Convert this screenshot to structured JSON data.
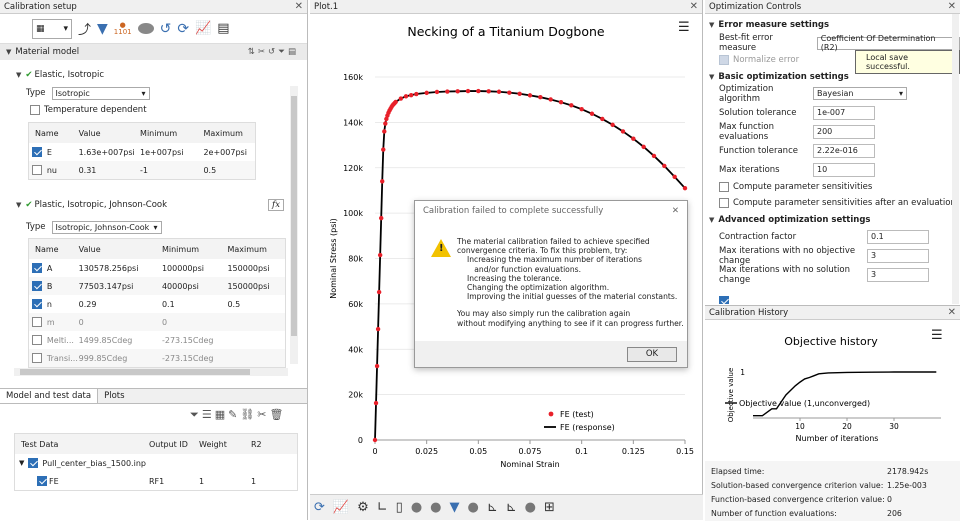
{
  "left": {
    "title": "Calibration setup",
    "section": "Material model",
    "elastic": {
      "name": "Elastic, Isotropic",
      "type_label": "Type",
      "type_value": "Isotropic",
      "temp_label": "Temperature dependent",
      "columns": [
        "Name",
        "Value",
        "Minimum",
        "Maximum"
      ],
      "rows": [
        {
          "name": "E",
          "value": "1.63e+007psi",
          "min": "1e+007psi",
          "max": "2e+007psi",
          "checked": true
        },
        {
          "name": "nu",
          "value": "0.31",
          "min": "-1",
          "max": "0.5",
          "checked": false
        }
      ]
    },
    "plastic": {
      "name": "Plastic, Isotropic, Johnson-Cook",
      "fx": "fx",
      "type_label": "Type",
      "type_value": "Isotropic, Johnson-Cook",
      "columns": [
        "Name",
        "Value",
        "Minimum",
        "Maximum"
      ],
      "rows": [
        {
          "name": "A",
          "value": "130578.256psi",
          "min": "100000psi",
          "max": "150000psi",
          "checked": true
        },
        {
          "name": "B",
          "value": "77503.147psi",
          "min": "40000psi",
          "max": "150000psi",
          "checked": true
        },
        {
          "name": "n",
          "value": "0.29",
          "min": "0.1",
          "max": "0.5",
          "checked": true
        },
        {
          "name": "m",
          "value": "0",
          "min": "0",
          "max": "",
          "checked": false
        },
        {
          "name": "Melti...",
          "value": "1499.85Cdeg",
          "min": "-273.15Cdeg",
          "max": "",
          "checked": false
        },
        {
          "name": "Transi...",
          "value": "999.85Cdeg",
          "min": "-273.15Cdeg",
          "max": "",
          "checked": false
        }
      ]
    },
    "tabs": [
      "Model and test data",
      "Plots"
    ],
    "data_table": {
      "columns": [
        "Test Data",
        "Output ID",
        "Weight",
        "R2"
      ],
      "parent": "Pull_center_bias_1500.inp",
      "child": {
        "name": "FE",
        "output": "RF1",
        "weight": "1",
        "r2": "1"
      }
    }
  },
  "plot": {
    "tab": "Plot.1",
    "chart_data": {
      "type": "scatter",
      "title": "Necking of a Titanium Dogbone",
      "xlabel": "Nominal Strain",
      "ylabel": "Nominal Stress (psi)",
      "xlim": [
        0,
        0.15
      ],
      "ylim": [
        0,
        160000
      ],
      "xticks": [
        "0",
        "0.025",
        "0.05",
        "0.075",
        "0.1",
        "0.125",
        "0.15"
      ],
      "yticks": [
        "0",
        "20k",
        "40k",
        "60k",
        "80k",
        "100k",
        "120k",
        "140k",
        "160k"
      ],
      "series": [
        {
          "name": "FE (test)",
          "style": "markers",
          "color": "#e8202a",
          "x": [
            0,
            0.0005,
            0.001,
            0.0015,
            0.002,
            0.0025,
            0.003,
            0.0035,
            0.004,
            0.0045,
            0.005,
            0.0055,
            0.006,
            0.0065,
            0.007,
            0.0075,
            0.008,
            0.0085,
            0.009,
            0.0095,
            0.01,
            0.0125,
            0.015,
            0.0175,
            0.02,
            0.025,
            0.03,
            0.035,
            0.04,
            0.045,
            0.05,
            0.055,
            0.06,
            0.065,
            0.07,
            0.075,
            0.08,
            0.085,
            0.09,
            0.095,
            0.1,
            0.105,
            0.11,
            0.115,
            0.12,
            0.125,
            0.13,
            0.135,
            0.14,
            0.145,
            0.15
          ],
          "y": [
            0,
            16300,
            32600,
            48900,
            65200,
            81500,
            97800,
            114000,
            128000,
            136000,
            139500,
            141500,
            143000,
            144200,
            145200,
            146000,
            146800,
            147500,
            148000,
            148500,
            149000,
            150500,
            151500,
            152000,
            152500,
            153000,
            153400,
            153600,
            153700,
            153800,
            153800,
            153700,
            153500,
            153100,
            152600,
            151900,
            151100,
            150100,
            148900,
            147500,
            145800,
            143800,
            141500,
            138900,
            136000,
            132800,
            129200,
            125200,
            120800,
            116000,
            111000
          ]
        },
        {
          "name": "FE (response)",
          "style": "line",
          "color": "#000000",
          "x": [
            0,
            0.0005,
            0.001,
            0.0015,
            0.002,
            0.0025,
            0.003,
            0.0035,
            0.004,
            0.0045,
            0.005,
            0.0055,
            0.006,
            0.0065,
            0.007,
            0.0075,
            0.008,
            0.0085,
            0.009,
            0.0095,
            0.01,
            0.0125,
            0.015,
            0.0175,
            0.02,
            0.025,
            0.03,
            0.035,
            0.04,
            0.045,
            0.05,
            0.055,
            0.06,
            0.065,
            0.07,
            0.075,
            0.08,
            0.085,
            0.09,
            0.095,
            0.1,
            0.105,
            0.11,
            0.115,
            0.12,
            0.125,
            0.13,
            0.135,
            0.14,
            0.145,
            0.15
          ],
          "y": [
            0,
            16300,
            32600,
            48900,
            65200,
            81500,
            97800,
            114000,
            128000,
            136000,
            139500,
            141500,
            143000,
            144200,
            145200,
            146000,
            146800,
            147500,
            148000,
            148500,
            149000,
            150500,
            151500,
            152000,
            152500,
            153000,
            153400,
            153600,
            153700,
            153800,
            153800,
            153700,
            153500,
            153100,
            152600,
            151900,
            151100,
            150100,
            148900,
            147500,
            145800,
            143800,
            141500,
            138900,
            136000,
            132800,
            129200,
            125200,
            120800,
            116000,
            111000
          ]
        }
      ]
    }
  },
  "dialog": {
    "title": "Calibration failed to complete successfully",
    "lines": [
      "The material calibration failed to achieve specified",
      "convergence criteria.  To fix this problem, try:"
    ],
    "indent": [
      "Increasing the maximum number of iterations",
      "   and/or function evaluations.",
      "Increasing the tolerance.",
      "Changing the optimization algorithm.",
      "Improving the initial guesses of the material constants."
    ],
    "footer": [
      "You may also simply run the calibration again",
      "without modifying anything to see if it can progress further."
    ],
    "ok": "OK"
  },
  "opt": {
    "title": "Optimization Controls",
    "err_section": "Error measure settings",
    "best_fit_label": "Best-fit error measure",
    "best_fit_value": "Coefficient Of Determination (R2)",
    "normalize_label": "Normalize error",
    "tooltip": "Local save successful.",
    "basic_section": "Basic optimization settings",
    "fields": [
      {
        "label": "Optimization algorithm",
        "value": "Bayesian",
        "kind": "select"
      },
      {
        "label": "Solution tolerance",
        "value": "1e-007"
      },
      {
        "label": "Max function evaluations",
        "value": "200"
      },
      {
        "label": "Function tolerance",
        "value": "2.22e-016"
      },
      {
        "label": "Max iterations",
        "value": "10"
      }
    ],
    "checks": [
      "Compute parameter sensitivities",
      "Compute parameter sensitivities after an evaluation"
    ],
    "adv_section": "Advanced optimization settings",
    "adv_fields": [
      {
        "label": "Contraction factor",
        "value": "0.1"
      },
      {
        "label": "Max iterations with no objective change",
        "value": "3"
      },
      {
        "label": "Max iterations with no solution change",
        "value": "3"
      }
    ]
  },
  "history": {
    "title": "Calibration History",
    "chart_data": {
      "type": "line",
      "title": "Objective history",
      "xlabel": "Number of iterations",
      "ylabel": "Objective value",
      "legend": "Objective value (1,unconverged)",
      "xticks": [
        "10",
        "20",
        "30"
      ],
      "yticks": [
        "1"
      ],
      "x": [
        0,
        2,
        4,
        5,
        6,
        7,
        8,
        9,
        10,
        11,
        12,
        13,
        14,
        16,
        20,
        25,
        30,
        35,
        39
      ],
      "y": [
        0.05,
        0.05,
        0.2,
        0.2,
        0.35,
        0.5,
        0.6,
        0.7,
        0.78,
        0.85,
        0.88,
        0.92,
        0.96,
        0.98,
        0.99,
        0.995,
        1,
        1,
        1
      ]
    },
    "stats": [
      {
        "label": "Elapsed time:",
        "value": "2178.942s"
      },
      {
        "label": "Solution-based convergence criterion value:",
        "value": "1.25e-003"
      },
      {
        "label": "Function-based convergence criterion value:",
        "value": "0"
      },
      {
        "label": "Number of function evaluations:",
        "value": "206"
      }
    ]
  }
}
